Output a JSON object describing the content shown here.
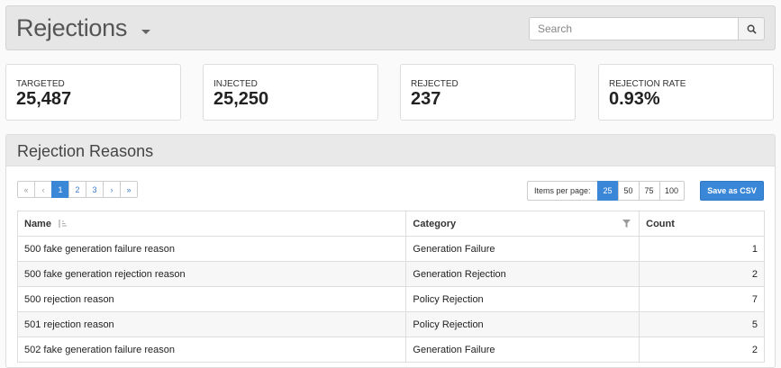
{
  "header": {
    "title": "Rejections",
    "search_placeholder": "Search"
  },
  "stats": [
    {
      "label": "TARGETED",
      "value": "25,487"
    },
    {
      "label": "INJECTED",
      "value": "25,250"
    },
    {
      "label": "REJECTED",
      "value": "237"
    },
    {
      "label": "REJECTION RATE",
      "value": "0.93%"
    }
  ],
  "panel": {
    "title": "Rejection Reasons",
    "pagination": {
      "first": "«",
      "prev": "‹",
      "pages": [
        "1",
        "2",
        "3"
      ],
      "next": "›",
      "last": "»",
      "current": "1"
    },
    "items_per_page": {
      "label": "Items per page:",
      "options": [
        "25",
        "50",
        "75",
        "100"
      ],
      "selected": "25"
    },
    "save_csv_label": "Save as CSV",
    "columns": [
      "Name",
      "Category",
      "Count"
    ],
    "rows": [
      {
        "name": "500 fake generation failure reason",
        "category": "Generation Failure",
        "count": "1"
      },
      {
        "name": "500 fake generation rejection reason",
        "category": "Generation Rejection",
        "count": "2"
      },
      {
        "name": "500 rejection reason",
        "category": "Policy Rejection",
        "count": "7"
      },
      {
        "name": "501 rejection reason",
        "category": "Policy Rejection",
        "count": "5"
      },
      {
        "name": "502 fake generation failure reason",
        "category": "Generation Failure",
        "count": "2"
      }
    ]
  },
  "colors": {
    "accent": "#3a87d8",
    "header_bg": "#e6e6e6"
  },
  "icons": {
    "title_dropdown": "caret-down-icon",
    "search": "search-icon",
    "sort": "sort-ascending-icon",
    "filter": "filter-icon"
  }
}
